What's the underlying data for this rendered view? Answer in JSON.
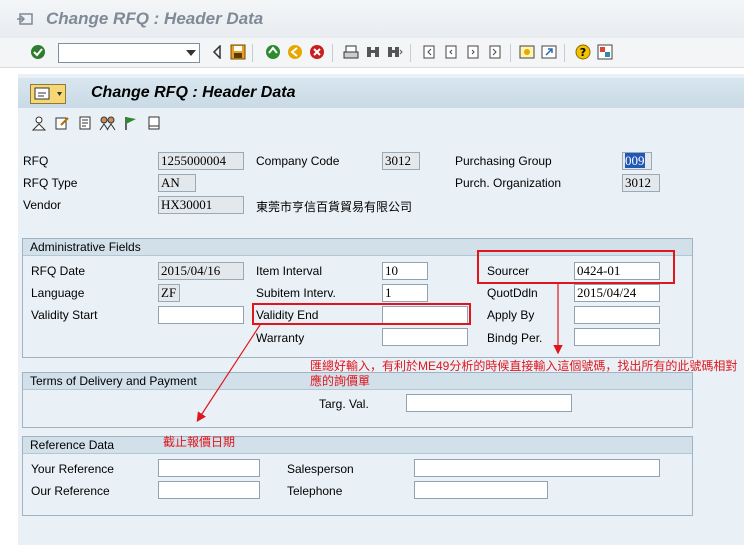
{
  "window": {
    "title": "Change RFQ : Header Data"
  },
  "toolbar": {
    "command_value": "",
    "icons": [
      "enter-icon",
      "back-icon",
      "save-icon",
      "exit-icon",
      "cancel-icon",
      "print-icon",
      "find-icon",
      "find-next-icon",
      "first-page-icon",
      "prev-page-icon",
      "next-page-icon",
      "last-page-icon",
      "new-session-icon",
      "shortcut-icon",
      "help-icon",
      "layout-icon"
    ]
  },
  "screen": {
    "title": "Change RFQ : Header Data"
  },
  "header": {
    "rfq": {
      "label": "RFQ",
      "value": "1255000004"
    },
    "rfq_type": {
      "label": "RFQ Type",
      "value": "AN"
    },
    "vendor": {
      "label": "Vendor",
      "value": "HX30001",
      "name": "東莞市亨信百貨貿易有限公司"
    },
    "company_code": {
      "label": "Company Code",
      "value": "3012"
    },
    "purch_group": {
      "label": "Purchasing Group",
      "value": "009"
    },
    "purch_org": {
      "label": "Purch. Organization",
      "value": "3012"
    }
  },
  "admin": {
    "title": "Administrative Fields",
    "rfq_date": {
      "label": "RFQ Date",
      "value": "2015/04/16"
    },
    "language": {
      "label": "Language",
      "value": "ZF"
    },
    "validity_start": {
      "label": "Validity Start",
      "value": ""
    },
    "item_interval": {
      "label": "Item Interval",
      "value": "10"
    },
    "subitem_interval": {
      "label": "Subitem Interv.",
      "value": "1"
    },
    "validity_end": {
      "label": "Validity End",
      "value": ""
    },
    "warranty": {
      "label": "Warranty",
      "value": ""
    },
    "sourcer": {
      "label": "Sourcer",
      "value": "0424-01"
    },
    "quot_deadline": {
      "label": "QuotDdln",
      "value": "2015/04/24"
    },
    "apply_by": {
      "label": "Apply By",
      "value": ""
    },
    "binding_period": {
      "label": "Bindg Per.",
      "value": ""
    }
  },
  "delivery": {
    "title": "Terms of Delivery and Payment",
    "target_value": {
      "label": "Targ. Val.",
      "value": ""
    }
  },
  "reference": {
    "title": "Reference Data",
    "your_reference": {
      "label": "Your Reference",
      "value": ""
    },
    "our_reference": {
      "label": "Our Reference",
      "value": ""
    },
    "salesperson": {
      "label": "Salesperson",
      "value": ""
    },
    "telephone": {
      "label": "Telephone",
      "value": ""
    }
  },
  "annotations": {
    "sourcer_note": "匯總好輸入，有利於ME49分析的時候直接輸入這個號碼，找出所有的此號碼相對應的詢價單",
    "deadline_note": "截止報價日期",
    "color": "#e0161c"
  }
}
